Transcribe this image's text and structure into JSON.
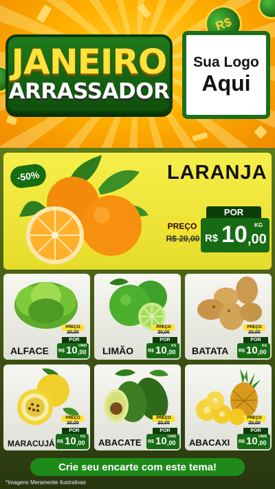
{
  "header": {
    "title_line1": "JANEIRO",
    "title_line2": "ARRASSADOR",
    "logo_line1": "Sua Logo",
    "logo_line2": "Aqui",
    "coin_symbol": "R$"
  },
  "featured": {
    "discount": "-50%",
    "name": "LARANJA",
    "por_label": "POR",
    "preco_label": "PREÇO",
    "old_price": "R$ 20,00",
    "currency": "R$",
    "price_int": "10",
    "price_dec": ",00",
    "unit": "KG"
  },
  "products": [
    {
      "name": "ALFACE",
      "preco_label": "PREÇO",
      "old_price": "20,00",
      "por_label": "POR",
      "currency": "R$",
      "price_int": "10",
      "price_dec": ",00",
      "unit": "UNID"
    },
    {
      "name": "LIMÃO",
      "preco_label": "PREÇO",
      "old_price": "20,00",
      "por_label": "POR",
      "currency": "R$",
      "price_int": "10",
      "price_dec": ",00",
      "unit": "KG"
    },
    {
      "name": "BATATA",
      "preco_label": "PREÇO",
      "old_price": "20,00",
      "por_label": "POR",
      "currency": "R$",
      "price_int": "10",
      "price_dec": ",00",
      "unit": "KG"
    },
    {
      "name": "MARACUJÁ",
      "preco_label": "PREÇO",
      "old_price": "20,00",
      "por_label": "POR",
      "currency": "R$",
      "price_int": "10",
      "price_dec": ",00",
      "unit": "KG"
    },
    {
      "name": "ABACATE",
      "preco_label": "PREÇO",
      "old_price": "20,00",
      "por_label": "POR",
      "currency": "R$",
      "price_int": "10",
      "price_dec": ",00",
      "unit": "UNID"
    },
    {
      "name": "ABACAXI",
      "preco_label": "PREÇO",
      "old_price": "20,00",
      "por_label": "POR",
      "currency": "R$",
      "price_int": "10",
      "price_dec": ",00",
      "unit": "UNID"
    }
  ],
  "footer": {
    "cta": "Crie seu encarte com este tema!",
    "disclaimer": "*Imagens Meramente Ilustrativas"
  },
  "colors": {
    "brand_green": "#176b14",
    "header_orange": "#ffb100",
    "featured_yellow": "#f6ef4a",
    "preco_yellow": "#ffe12a"
  }
}
